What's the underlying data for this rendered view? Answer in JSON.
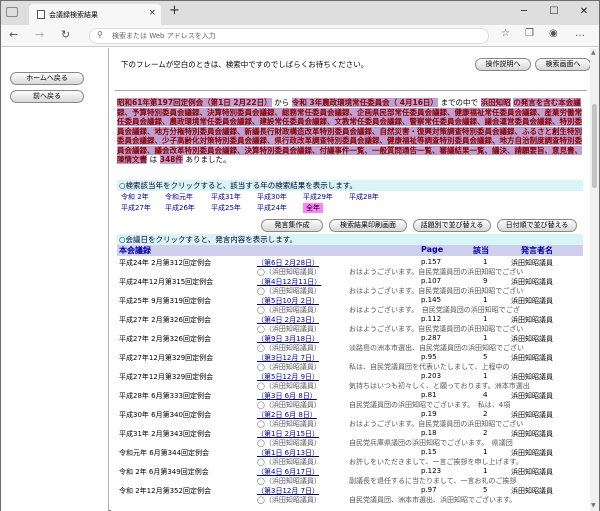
{
  "tab": {
    "title": "会議録検索結果",
    "close": "×",
    "new": "+"
  },
  "window_controls": {
    "min": "─",
    "max": "☐",
    "close": "✕"
  },
  "toolbar": {
    "back": "←",
    "forward": "→",
    "reload": "↻",
    "address_placeholder": "検索または Web アドレスを入力",
    "icons": [
      "favorite-star-icon",
      "collections-icon",
      "profile-icon",
      "more-icon"
    ]
  },
  "left": {
    "home_button": "ホームへ戻る",
    "back_button": "前へ戻る"
  },
  "main": {
    "notice": "下のフレームが空白のときは、検索中ですのでしばらくお待ちください。",
    "help_button": "操作説明へ",
    "search_screen_button": "検索画面へ",
    "summary": {
      "from": "昭和61年第197回定例会（第1日 2月22日）",
      "conj1": "から",
      "to": "令和 3年農政環境常任委員会（ 4月16日）",
      "conj2": "までの中で",
      "keyword": "浜田知昭",
      "body": "の発言を含む本会議録、予算特別委員会議録、決算特別委員会議録、総務常任委員会議録、企画県民部常任委員会議録、健康福祉常任委員会議録、産業労働常任委員会議録、農政環境常任委員会議録、建設常任委員会議録、文教常任委員会議録、警察常任委員会議録、議会運営委員会議録、特別委員会議録、地方分権特別委員会議録、新議長行財政構造改革特別委員会議録、自然災害・復興対策調査特別委員会議録、ふるさと創生特別委員会議録、少子高齢化対策特別委員会議録、県行政改革調査特別委員会議録、健康福祉等調査特別委員会議録、地方自治制度調査特別委員会議録、議会改革特別委員会議録、決算特別委員会議録、付議事件一覧、一般質問通告一覧、審議結果一覧、議決、請願要旨、意見書、陳情文書",
      "conj3": "は",
      "count": "348件",
      "tail": "ありました。"
    },
    "year_section": "○検索該当年をクリックすると、該当する年の検索結果を表示します。",
    "years": [
      "令和 2年",
      "令和元年",
      "平成31年",
      "平成30年",
      "平成29年",
      "平成28年",
      "平成27年",
      "平成26年",
      "平成25年",
      "平成24年",
      "全年"
    ],
    "actions": [
      "発言集作成",
      "検索結果印刷画面",
      "話題別で並び替える",
      "日付順で並び替える"
    ],
    "list_section": "○会議日をクリックすると、発言内容を表示します。",
    "table_headers": {
      "type": "本会議録",
      "page": "Page",
      "count": "該当",
      "speaker": "発言者名"
    },
    "rows": [
      {
        "session": "平成24年 2月第312回定例会",
        "date": "（第6日 2月28日）",
        "page": "p.157",
        "num": "1",
        "speaker": "浜田知昭議員",
        "name": "◯（浜田知昭議員）",
        "excerpt": "おはようございます。自民党議員団の浜田知昭でござい"
      },
      {
        "session": "平成24年12月第315回定例会",
        "date": "（第4日12月11日）",
        "page": "p.107",
        "num": "9",
        "speaker": "浜田知昭議員",
        "name": "◯（浜田知昭議員）",
        "excerpt": "おはようございます。自民党議員団の浜田知昭でござい"
      },
      {
        "session": "平成25年 9月第319回定例会",
        "date": "（第5日10月 2日）",
        "page": "p.145",
        "num": "1",
        "speaker": "浜田知昭議員",
        "name": "◯（浜田知昭議員）",
        "excerpt": "おはようございます。　自民党議員団の浜田知昭でござ"
      },
      {
        "session": "平成27年 2月第326回定例会",
        "date": "（第4日 2月23日）",
        "page": "p.112",
        "num": "1",
        "speaker": "浜田知昭議員",
        "name": "◯（浜田知昭議員）",
        "excerpt": "おはようございます。自民党議員団の浜田知昭でござい"
      },
      {
        "session": "平成27年 2月第326回定例会",
        "date": "（第9日 3月18日）",
        "page": "p.287",
        "num": "1",
        "speaker": "浜田知昭議員",
        "name": "◯（浜田知昭議員）",
        "excerpt": "淡路島の洲本市選出、自民党議員団の浜田知昭でござい"
      },
      {
        "session": "平成27年12月第329回定例会",
        "date": "（第3日12月 7日）",
        "page": "p.95",
        "num": "5",
        "speaker": "浜田知昭議員",
        "name": "◯（浜田知昭議員）",
        "excerpt": "私は、自民党議員団を代表いたしまして、上程中の"
      },
      {
        "session": "平成27年12月第329回定例会",
        "date": "（第5日12月 9日）",
        "page": "p.203",
        "num": "1",
        "speaker": "浜田知昭議員",
        "name": "◯（浜田知昭議員）",
        "excerpt": "気持ちはいつも初々しく、と願っております。洲本市選出"
      },
      {
        "session": "平成28年 6月第333回定例会",
        "date": "（第3日 6月 8日）",
        "page": "p.81",
        "num": "4",
        "speaker": "浜田知昭議員",
        "name": "◯（浜田知昭議員）",
        "excerpt": "自民党議員団の浜田知昭でございます。　私は、4項"
      },
      {
        "session": "平成30年 6月第340回定例会",
        "date": "（第2日 6月 8日）",
        "page": "p.19",
        "num": "2",
        "speaker": "浜田知昭議員",
        "name": "◯（浜田知昭議員）",
        "excerpt": "おはようございます。自民党議員団の浜田知昭でござい"
      },
      {
        "session": "平成31年 2月第343回定例会",
        "date": "（第1日 2月15日）",
        "page": "p.18",
        "num": "2",
        "speaker": "浜田知昭議員",
        "name": "◯（浜田知昭議員）",
        "excerpt": "自民党兵庫県議団の浜田知昭でございます。　県議団"
      },
      {
        "session": "令和元年 6月第344回定例会",
        "date": "（第1日 6月13日）",
        "page": "p.15",
        "num": "1",
        "speaker": "浜田知昭議員",
        "name": "◯（浜田知昭議員）",
        "excerpt": "お許しをいただきまして、一言ご挨拶を申し上げます。"
      },
      {
        "session": "令和 2年 6月第349回定例会",
        "date": "（第4日 6月17日）",
        "page": "p.123",
        "num": "1",
        "speaker": "浜田知昭議員",
        "name": "◯（浜田知昭議員）",
        "excerpt": "副議長を退任するに当たりまして、一言お礼のご挨拶"
      },
      {
        "session": "令和 2年12月第352回定例会",
        "date": "（第3日12月 7日）",
        "page": "p.97",
        "num": "5",
        "speaker": "浜田知昭議員",
        "name": "◯（浜田知昭議員）",
        "excerpt": "自民党議員団、洲本市選出、浜田知昭でございます。"
      }
    ]
  }
}
